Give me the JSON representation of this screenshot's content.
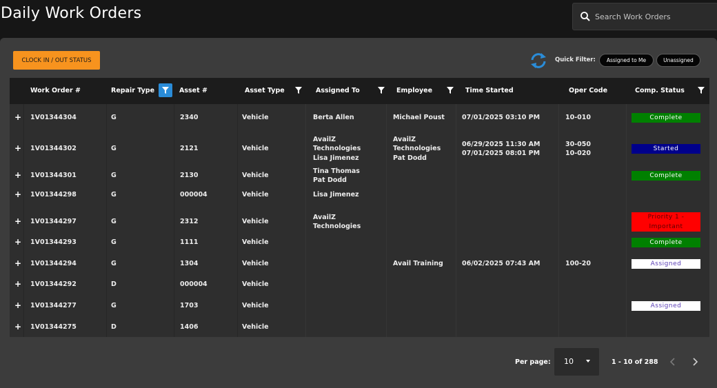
{
  "header": {
    "title": "Daily Work Orders",
    "search_placeholder": "Search Work Orders"
  },
  "toolbar": {
    "clock_label": "CLOCK IN / OUT STATUS",
    "quick_filter_label": "Quick Filter:",
    "filters": [
      "Assigned to Me",
      "Unassigned"
    ]
  },
  "table": {
    "columns": [
      "Work Order #",
      "Repair Type",
      "Asset #",
      "Asset Type",
      "Assigned To",
      "Employee",
      "Time Started",
      "Oper Code",
      "Comp. Status"
    ],
    "rows": [
      {
        "work_order": "1V01344304",
        "repair_type": "G",
        "asset": "2340",
        "asset_type": "Vehicle",
        "assigned_to": "Berta Allen",
        "employee": "Michael Poust",
        "time_started": "07/01/2025 03:10 PM",
        "oper_code": "10-010",
        "status": "Complete"
      },
      {
        "work_order": "1V01344302",
        "repair_type": "G",
        "asset": "2121",
        "asset_type": "Vehicle",
        "assigned_to": "AvailZ\nTechnologies\nLisa Jimenez",
        "employee": "AvailZ\nTechnologies\nPat Dodd",
        "time_started": "06/29/2025 11:30 AM\n07/01/2025 08:01 PM",
        "oper_code": "30-050\n10-020",
        "status": "Started"
      },
      {
        "work_order": "1V01344301",
        "repair_type": "G",
        "asset": "2130",
        "asset_type": "Vehicle",
        "assigned_to": "Tina Thomas\nPat Dodd",
        "employee": "",
        "time_started": "",
        "oper_code": "",
        "status": "Complete"
      },
      {
        "work_order": "1V01344298",
        "repair_type": "G",
        "asset": "000004",
        "asset_type": "Vehicle",
        "assigned_to": "Lisa Jimenez",
        "employee": "",
        "time_started": "",
        "oper_code": "",
        "status": ""
      },
      {
        "work_order": "1V01344297",
        "repair_type": "G",
        "asset": "2312",
        "asset_type": "Vehicle",
        "assigned_to": "AvailZ\nTechnologies",
        "employee": "",
        "time_started": "",
        "oper_code": "",
        "status": "Priority 1 - Important"
      },
      {
        "work_order": "1V01344293",
        "repair_type": "G",
        "asset": "1111",
        "asset_type": "Vehicle",
        "assigned_to": "",
        "employee": "",
        "time_started": "",
        "oper_code": "",
        "status": "Complete"
      },
      {
        "work_order": "1V01344294",
        "repair_type": "G",
        "asset": "1304",
        "asset_type": "Vehicle",
        "assigned_to": "",
        "employee": "Avail Training",
        "time_started": "06/02/2025 07:43 AM",
        "oper_code": "100-20",
        "status": "Assigned"
      },
      {
        "work_order": "1V01344292",
        "repair_type": "D",
        "asset": "000004",
        "asset_type": "Vehicle",
        "assigned_to": "",
        "employee": "",
        "time_started": "",
        "oper_code": "",
        "status": ""
      },
      {
        "work_order": "1V01344277",
        "repair_type": "G",
        "asset": "1703",
        "asset_type": "Vehicle",
        "assigned_to": "",
        "employee": "",
        "time_started": "",
        "oper_code": "",
        "status": "Assigned"
      },
      {
        "work_order": "1V01344275",
        "repair_type": "D",
        "asset": "1406",
        "asset_type": "Vehicle",
        "assigned_to": "",
        "employee": "",
        "time_started": "",
        "oper_code": "",
        "status": ""
      }
    ]
  },
  "pagination": {
    "per_page_label": "Per page:",
    "per_page_value": "10",
    "range": "1 - 10 of 288"
  },
  "colors": {
    "accent": "#f7931e",
    "complete": "#008000",
    "started": "#00008b",
    "priority": "#ff0000",
    "assigned_bg": "#ffffff",
    "filter_active": "#2a8cd8"
  },
  "icons": {
    "search": "search-icon",
    "refresh": "refresh-icon",
    "filter": "filter-icon",
    "expand": "plus-icon",
    "prev": "chevron-left-icon",
    "next": "chevron-right-icon"
  }
}
